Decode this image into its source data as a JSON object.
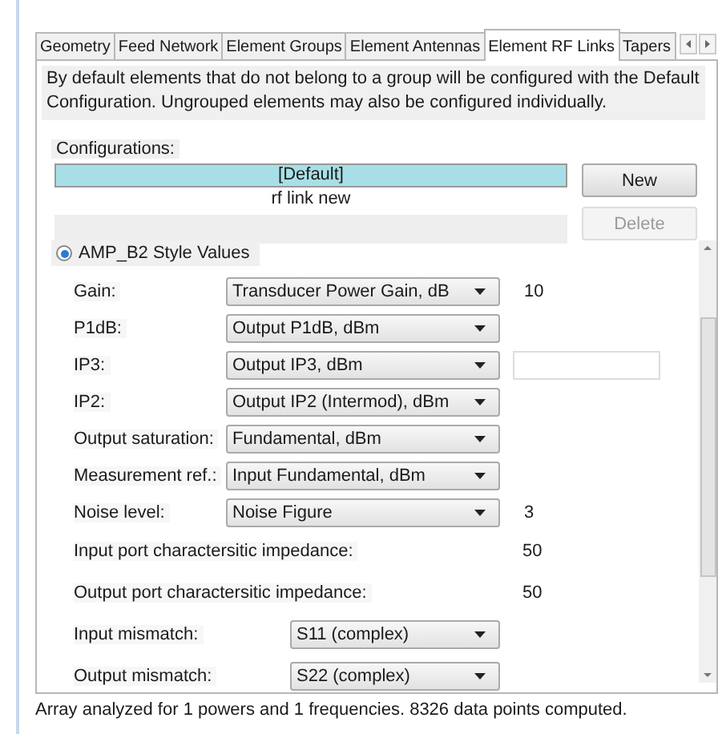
{
  "tabs": [
    {
      "label": "Geometry",
      "selected": false
    },
    {
      "label": "Feed Network",
      "selected": false
    },
    {
      "label": "Element Groups",
      "selected": false
    },
    {
      "label": "Element Antennas",
      "selected": false
    },
    {
      "label": "Element RF Links",
      "selected": true
    },
    {
      "label": "Tapers",
      "selected": false
    }
  ],
  "description": "By default elements that do not belong to a group will be configured with the Default Configuration. Ungrouped elements may also be configured individually.",
  "configurations": {
    "label": "Configurations:",
    "items": [
      {
        "label": "[Default]",
        "selected": true
      },
      {
        "label": "rf link new",
        "selected": false
      }
    ]
  },
  "buttons": [
    {
      "label": "New",
      "disabled": false
    },
    {
      "label": "Delete",
      "disabled": true
    }
  ],
  "section": {
    "label": "AMP_B2 Style Values",
    "checked": true
  },
  "params": [
    {
      "kind": "select",
      "label": "Gain:",
      "value": "Transducer Power Gain, dB",
      "reading": "10"
    },
    {
      "kind": "select",
      "label": "P1dB:",
      "value": "Output P1dB, dBm"
    },
    {
      "kind": "select",
      "label": "IP3:",
      "value": "Output IP3, dBm",
      "field": true
    },
    {
      "kind": "select",
      "label": "IP2:",
      "value": "Output IP2 (Intermod), dBm"
    },
    {
      "kind": "select",
      "label": "Output saturation:",
      "value": "Fundamental, dBm"
    },
    {
      "kind": "select",
      "label": "Measurement ref.:",
      "value": "Input Fundamental, dBm"
    },
    {
      "kind": "select",
      "label": "Noise level:",
      "value": "Noise Figure",
      "reading": "3"
    },
    {
      "kind": "value",
      "label": "Input port charactersitic impedance:",
      "reading": "50"
    },
    {
      "kind": "value",
      "label": "Output port charactersitic impedance:",
      "reading": "50"
    },
    {
      "kind": "mismatch",
      "label": "Input mismatch:",
      "value": "S11 (complex)"
    },
    {
      "kind": "mismatch",
      "label": "Output mismatch:",
      "value": "S22 (complex)"
    }
  ],
  "status": "Array analyzed for 1 powers and 1 frequencies. 8326 data points computed."
}
